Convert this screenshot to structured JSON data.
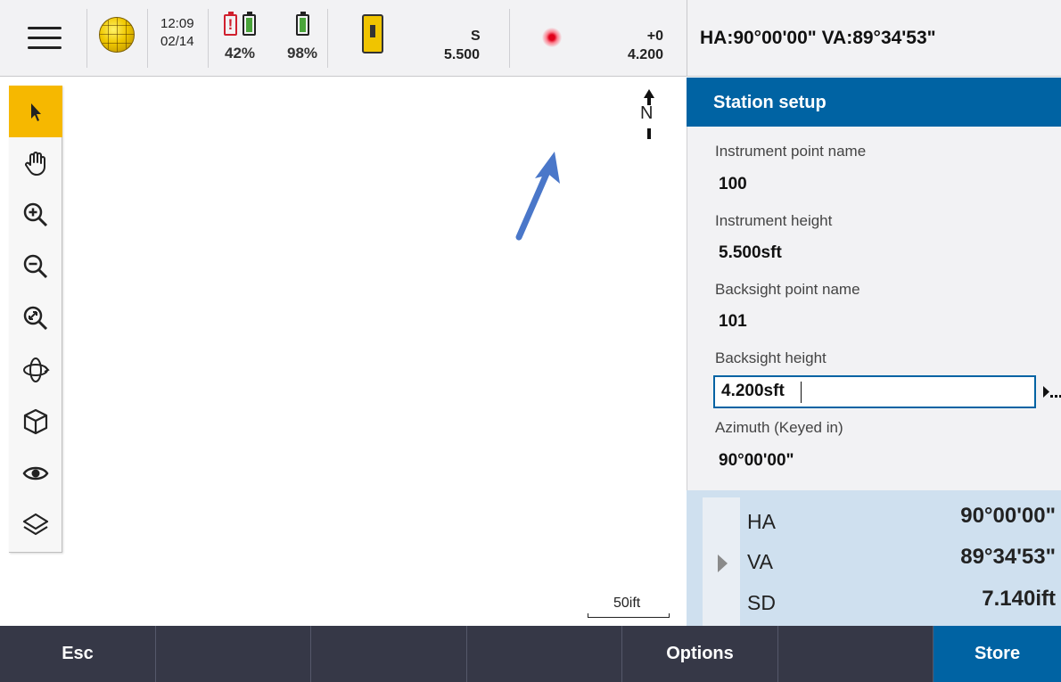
{
  "status_bar": {
    "time": "12:09",
    "date": "02/14",
    "battery_controller_pct": "42%",
    "battery_instrument_pct": "98%",
    "instrument_mode": "S",
    "instrument_height": "5.500",
    "target_offset": "+0",
    "target_height": "4.200"
  },
  "angle_header": "HA:90°00'00\"  VA:89°34'53\"",
  "map": {
    "north_label": "N",
    "scale_label": "50ift",
    "tools": [
      "select-icon",
      "pan-icon",
      "zoom-in-icon",
      "zoom-out-icon",
      "zoom-extents-icon",
      "orbit-icon",
      "3d-view-icon",
      "visibility-icon",
      "layers-icon"
    ]
  },
  "panel": {
    "title": "Station setup",
    "fields": [
      {
        "label": "Instrument point name",
        "value": "100"
      },
      {
        "label": "Instrument height",
        "value": "5.500sft"
      },
      {
        "label": "Backsight point name",
        "value": "101"
      },
      {
        "label": "Backsight height",
        "value": "4.200sft"
      },
      {
        "label": "Azimuth (Keyed in)",
        "value": "90°00'00\""
      }
    ]
  },
  "readout": [
    {
      "label": "HA",
      "value": "90°00'00\""
    },
    {
      "label": "VA",
      "value": "89°34'53\""
    },
    {
      "label": "SD",
      "value": "7.140ift"
    }
  ],
  "bottom_bar": [
    "Esc",
    "",
    "",
    "",
    "Options",
    "",
    "Store"
  ],
  "colors": {
    "accent_blue": "#0063a3",
    "active_tool": "#f6b800",
    "bottom_bar": "#363847",
    "readout_bg": "#cfe0ef"
  }
}
